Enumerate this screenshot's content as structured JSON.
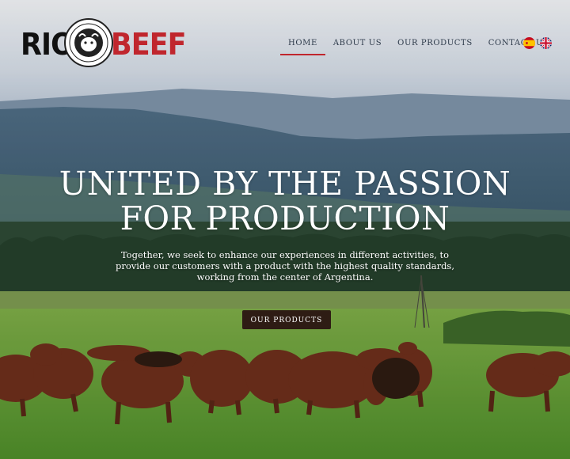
{
  "brand": {
    "name_part1": "RIO",
    "name_part2": "BEEF",
    "colors": {
      "dark": "#111111",
      "red": "#c0262d"
    }
  },
  "nav": {
    "items": [
      {
        "label": "HOME",
        "active": true
      },
      {
        "label": "ABOUT US",
        "active": false
      },
      {
        "label": "OUR PRODUCTS",
        "active": false
      },
      {
        "label": "CONTACT US",
        "active": false
      }
    ],
    "accent_color": "#c0262d"
  },
  "languages": [
    {
      "icon": "spain-flag-icon"
    },
    {
      "icon": "uk-flag-icon"
    }
  ],
  "hero": {
    "title_line1": "UNITED BY THE PASSION",
    "title_line2": "FOR PRODUCTION",
    "subtitle": "Together, we seek to enhance our experiences in different activities, to provide our customers with a product with the highest quality standards, working from the center of Argentina.",
    "cta_label": "OUR PRODUCTS",
    "cta_color": "#2e1c14"
  }
}
